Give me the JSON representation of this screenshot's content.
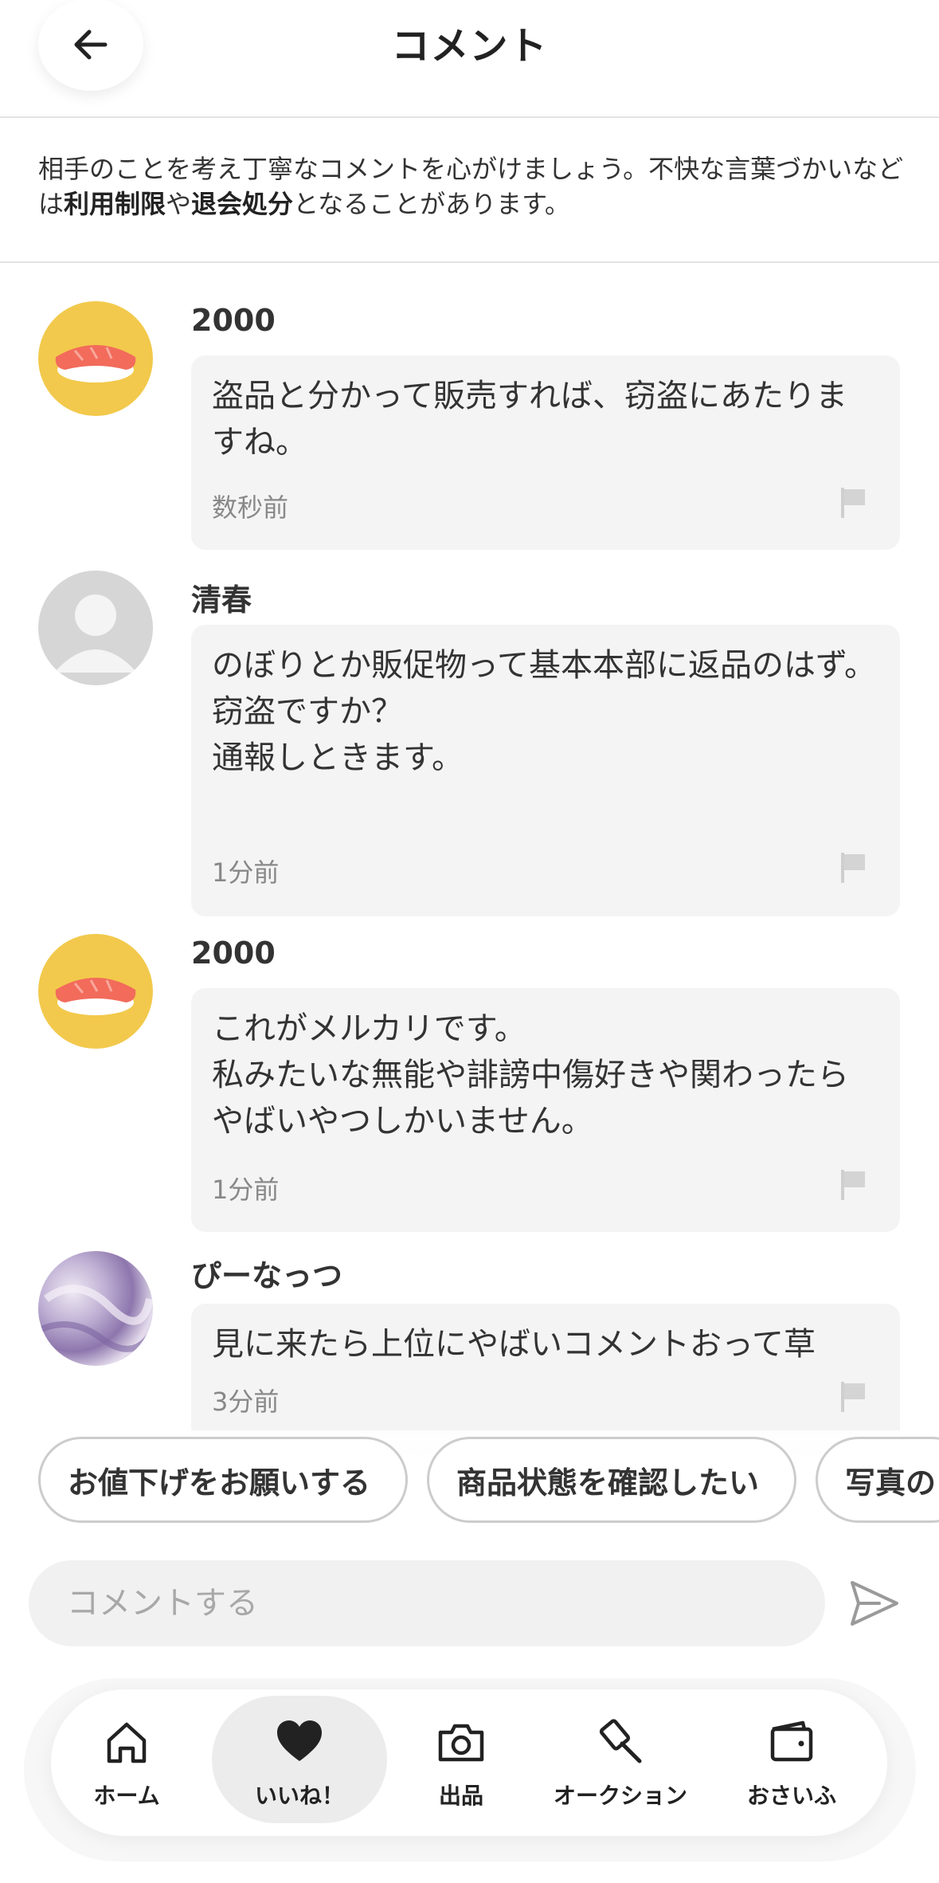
{
  "header": {
    "title": "コメント"
  },
  "notice": {
    "text_1": "相手のことを考え丁寧なコメントを心がけましょう。不快な言葉づかいなどは",
    "bold_1": "利用制限",
    "text_2": "や",
    "bold_2": "退会処分",
    "text_3": "となることがあります。"
  },
  "comments": [
    {
      "user": "2000",
      "text": "盗品と分かって販売すれば、窃盗にあたりますね。",
      "time": "数秒前",
      "avatar": "sushi"
    },
    {
      "user": "清春",
      "text": "のぼりとか販促物って基本本部に返品のはず。\n窃盗ですか？\n通報しときます。",
      "time": "1分前",
      "avatar": "default"
    },
    {
      "user": "2000",
      "text": "これがメルカリです。\n私みたいな無能や誹謗中傷好きや関わったらやばいやつしかいません。",
      "time": "1分前",
      "avatar": "sushi"
    },
    {
      "user": "ぴーなっつ",
      "text": "見に来たら上位にやばいコメントおって草",
      "time": "3分前",
      "avatar": "photo"
    }
  ],
  "suggestions": [
    "お値下げをお願いする",
    "商品状態を確認したい",
    "写真の"
  ],
  "input": {
    "placeholder": "コメントする"
  },
  "nav": {
    "items": [
      {
        "label": "ホーム",
        "icon": "home-icon"
      },
      {
        "label": "いいね！",
        "icon": "heart-icon",
        "active": true
      },
      {
        "label": "出品",
        "icon": "camera-icon"
      },
      {
        "label": "オークション",
        "icon": "gavel-icon"
      },
      {
        "label": "おさいふ",
        "icon": "wallet-icon"
      }
    ]
  },
  "colors": {
    "bubble": "#f4f4f4",
    "avatar_yellow": "#f2c94c",
    "salmon": "#f26b5b",
    "active_nav": "#ececec"
  }
}
